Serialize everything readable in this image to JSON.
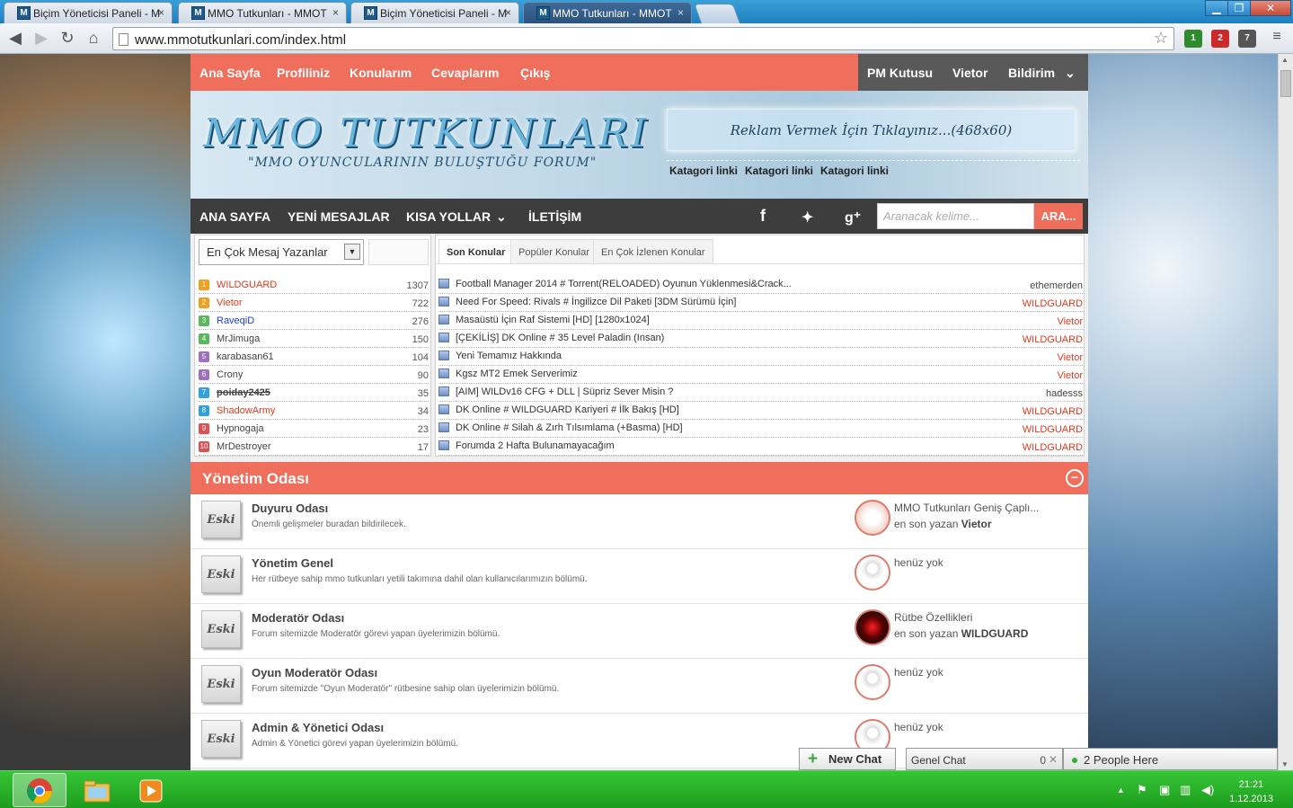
{
  "browser": {
    "tabs": [
      {
        "title": "Biçim Yöneticisi Paneli - M",
        "favicon": "M"
      },
      {
        "title": "MMO Tutkunları - MMOT",
        "favicon": "M"
      },
      {
        "title": "Biçim Yöneticisi Paneli - M",
        "favicon": "M"
      },
      {
        "title": "MMO Tutkunları - MMOT",
        "favicon": "M"
      }
    ],
    "tab_close": "×",
    "url": "www.mmotutkunlari.com/index.html",
    "win_min": "▁",
    "win_max": "❐",
    "win_close": "✕",
    "ext_badges": [
      "1",
      "2",
      "7"
    ]
  },
  "topnav": {
    "left": [
      "Ana Sayfa",
      "Profiliniz",
      "Konularım",
      "Cevaplarım",
      "Çıkış"
    ],
    "right": [
      "PM Kutusu",
      "Vietor",
      "Bildirim"
    ]
  },
  "header": {
    "logo": "MMO TUTKUNLARI",
    "slogan": "\"MMO OYUNCULARININ BULUŞTUĞU FORUM\"",
    "ad": "Reklam Vermek İçin Tıklayınız...(468x60)",
    "categories": [
      "Katagori linki",
      "Katagori linki",
      "Katagori linki"
    ]
  },
  "subnav": {
    "items": [
      "ANA SAYFA",
      "YENİ MESAJLAR",
      "KISA YOLLAR",
      "İLETİŞİM"
    ],
    "search_placeholder": "Aranacak kelime...",
    "search_button": "ARA..."
  },
  "posters": {
    "select_value": "En Çok Mesaj Yazanlar",
    "rows": [
      {
        "rank": "1",
        "name": "WILDGUARD",
        "count": "1307",
        "color": "#e03a1e",
        "badge": "#f0a020"
      },
      {
        "rank": "2",
        "name": "Vietor",
        "count": "722",
        "color": "#e03a1e",
        "badge": "#f0a020"
      },
      {
        "rank": "3",
        "name": "RaveqiD",
        "count": "276",
        "color": "#1f3fd6",
        "badge": "#5cb85c"
      },
      {
        "rank": "4",
        "name": "MrJimuga",
        "count": "150",
        "color": "#444444",
        "badge": "#5cb85c"
      },
      {
        "rank": "5",
        "name": "karabasan61",
        "count": "104",
        "color": "#444444",
        "badge": "#a070c0"
      },
      {
        "rank": "6",
        "name": "Crony",
        "count": "90",
        "color": "#444444",
        "badge": "#a070c0"
      },
      {
        "rank": "7",
        "name": "poiday2425",
        "count": "35",
        "color": "#444444",
        "badge": "#30a0e0"
      },
      {
        "rank": "8",
        "name": "ShadowArmy",
        "count": "34",
        "color": "#e03a1e",
        "badge": "#30a0e0"
      },
      {
        "rank": "9",
        "name": "Hypnogaja",
        "count": "23",
        "color": "#444444",
        "badge": "#e05050"
      },
      {
        "rank": "10",
        "name": "MrDestroyer",
        "count": "17",
        "color": "#444444",
        "badge": "#e05050"
      }
    ]
  },
  "topics": {
    "tabs": [
      "Son Konular",
      "Popüler Konular",
      "En Çok İzlenen Konular"
    ],
    "rows": [
      {
        "title": "Football Manager 2014 # Torrent(RELOADED) Oyunun Yüklenmesi&Crack...",
        "author": "ethemerden",
        "color": "#444444"
      },
      {
        "title": "Need For Speed: Rivals # İngilizce Dil Paketi [3DM Sürümü İçin]",
        "author": "WILDGUARD",
        "color": "#e03a1e"
      },
      {
        "title": "Masaüstü İçin Raf Sistemi [HD] [1280x1024]",
        "author": "Vietor",
        "color": "#e03a1e"
      },
      {
        "title": "[ÇEKİLİŞ] DK Online # 35 Level Paladin (Insan)",
        "author": "WILDGUARD",
        "color": "#e03a1e"
      },
      {
        "title": "Yeni Temamız Hakkında",
        "author": "Vietor",
        "color": "#e03a1e"
      },
      {
        "title": "Kgsz MT2 Emek Serverimiz",
        "author": "Vietor",
        "color": "#e03a1e"
      },
      {
        "title": "[AIM] WILDv16 CFG + DLL | Süpriz Sever Misin ?",
        "author": "hadesss",
        "color": "#444444"
      },
      {
        "title": "DK Online # WILDGUARD Kariyeri # İlk Bakış [HD]",
        "author": "WILDGUARD",
        "color": "#e03a1e"
      },
      {
        "title": "DK Online # Silah & Zırh Tılsımlama (+Basma) [HD]",
        "author": "WILDGUARD",
        "color": "#e03a1e"
      },
      {
        "title": "Forumda 2 Hafta Bulunamayacağım",
        "author": "WILDGUARD",
        "color": "#e03a1e"
      }
    ]
  },
  "section": {
    "title": "Yönetim Odası",
    "collapse": "−",
    "forums": [
      {
        "icon": "Eski",
        "title": "Duyuru Odası",
        "desc": "Önemli gelişmeler buradan bildirilecek.",
        "last": "MMO Tutkunları Geniş Çaplı...",
        "by_prefix": "en son yazan",
        "by": "Vietor",
        "avatar": "a1"
      },
      {
        "icon": "Eski",
        "title": "Yönetim Genel",
        "desc": "Her rütbeye sahip mmo tutkunları yetili takımına dahil olan kullanıcılarımızın bölümü.",
        "last": "henüz yok",
        "by_prefix": "",
        "by": "",
        "avatar": "a0"
      },
      {
        "icon": "Eski",
        "title": "Moderatör Odası",
        "desc": "Forum sitemizde Moderatör görevi yapan üyelerimizin bölümü.",
        "last": "Rütbe Özellikleri",
        "by_prefix": "en son yazan",
        "by": "WILDGUARD",
        "avatar": "a2"
      },
      {
        "icon": "Eski",
        "title": "Oyun Moderatör Odası",
        "desc": "Forum sitemizde \"Oyun Moderatör\" rütbesine sahip olan üyelerimizin bölümü.",
        "last": "henüz yok",
        "by_prefix": "",
        "by": "",
        "avatar": "a0"
      },
      {
        "icon": "Eski",
        "title": "Admin & Yönetici Odası",
        "desc": "Admin & Yönetici görevi yapan üyelerimizin bölümü.",
        "last": "henüz yok",
        "by_prefix": "",
        "by": "",
        "avatar": "a0"
      }
    ]
  },
  "chat": {
    "new_chat": "New Chat",
    "room": "Genel Chat",
    "room_count": "0",
    "people": "2 People Here"
  },
  "taskbar": {
    "time": "21:21",
    "date": "1.12.2013"
  },
  "colors": {
    "accent": "#ef6f5c",
    "dark": "#3d3d3d",
    "taskbar": "#22a822"
  }
}
